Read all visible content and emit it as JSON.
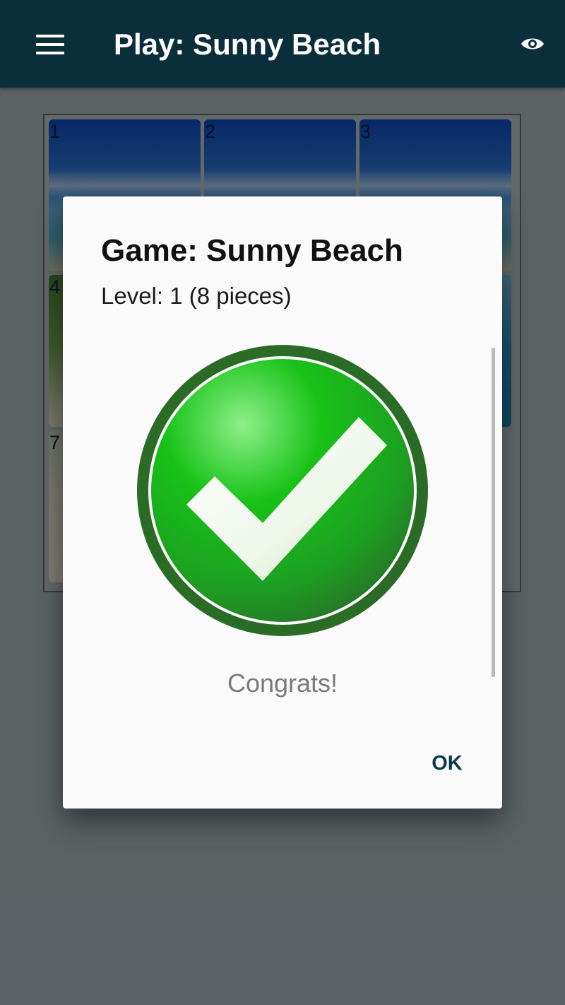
{
  "app_bar": {
    "title": "Play: Sunny Beach",
    "menu_icon": "hamburger-menu-icon",
    "eye_icon": "eye-icon",
    "background": "#0b2e3b"
  },
  "board": {
    "piece_numbers": [
      "1",
      "2",
      "3",
      "4",
      "",
      "",
      "7",
      "",
      ""
    ]
  },
  "dialog": {
    "title": "Game: Sunny Beach",
    "level": "Level: 1 (8 pieces)",
    "status_icon": "checkmark-success-icon",
    "message": "Congrats!",
    "ok_label": "OK"
  },
  "colors": {
    "accent_green": "#1fae1f",
    "ring_green": "#2a6b26",
    "ok_text": "#0b3a4f"
  }
}
